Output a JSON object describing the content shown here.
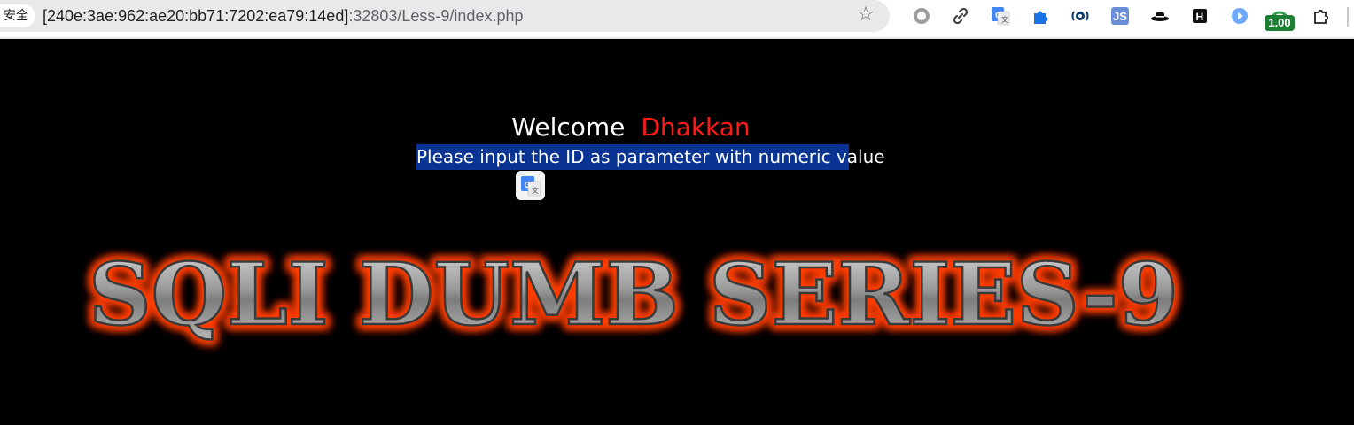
{
  "browser": {
    "security_label": "安全",
    "url_host": "[240e:3ae:962:ae20:bb71:7202:ea79:14ed]",
    "url_path": ":32803/Less-9/index.php",
    "bookmark_icon": "star-icon",
    "extensions": [
      "circle-extension-icon",
      "link-extension-icon",
      "google-translate-icon",
      "puzzle-blue-icon",
      "wave-extension-icon",
      "js-extension-icon",
      "hat-extension-icon",
      "h-extension-icon",
      "play-circle-icon",
      "gauge-extension-icon",
      "extensions-puzzle-icon"
    ],
    "badge_value": "1.00"
  },
  "page": {
    "welcome_label": "Welcome",
    "welcome_name": "Dhakkan",
    "instruction": "Please input the ID as parameter with numeric value",
    "banner_text": "SQLI DUMB SERIES-9",
    "colors": {
      "background": "#000000",
      "name_color": "#ff1a1a",
      "instruction_bg": "#0a3494",
      "banner_glow": "#ff5a00"
    }
  }
}
